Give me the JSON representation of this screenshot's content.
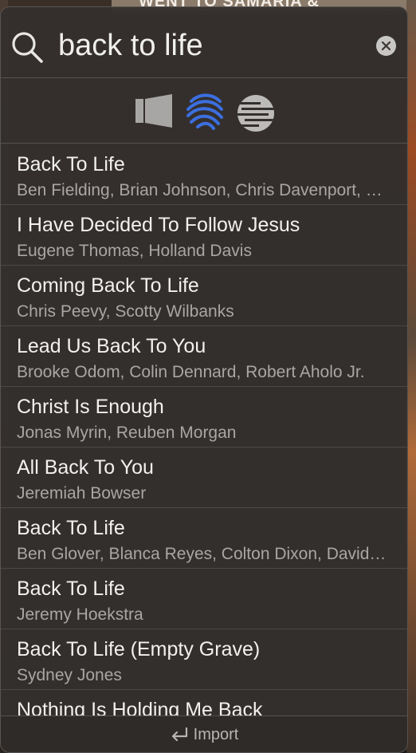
{
  "background": {
    "banner_text": "WENT TO SAMARIA &"
  },
  "search": {
    "query": "back to life",
    "icon": "magnifier-icon",
    "clear_icon": "clear-x-icon"
  },
  "sources": [
    {
      "name": "source-gray-icon",
      "color": "#a8a6a4"
    },
    {
      "name": "source-blue-icon",
      "color": "#3b6fe0"
    },
    {
      "name": "source-lines-icon",
      "color": "#bdbbb9"
    }
  ],
  "results": [
    {
      "title": "Back To Life",
      "subtitle": "Ben Fielding, Brian Johnson, Chris Davenport, Ed Cash"
    },
    {
      "title": "I Have Decided To Follow Jesus",
      "subtitle": "Eugene Thomas, Holland Davis"
    },
    {
      "title": "Coming Back To Life",
      "subtitle": "Chris Peevy, Scotty Wilbanks"
    },
    {
      "title": "Lead Us Back To You",
      "subtitle": "Brooke Odom, Colin Dennard, Robert Aholo Jr."
    },
    {
      "title": "Christ Is Enough",
      "subtitle": "Jonas Myrin, Reuben Morgan"
    },
    {
      "title": "All Back To You",
      "subtitle": "Jeremiah Bowser"
    },
    {
      "title": "Back To Life",
      "subtitle": "Ben Glover, Blanca Reyes, Colton Dixon, David Garcia"
    },
    {
      "title": "Back To Life",
      "subtitle": "Jeremy Hoekstra"
    },
    {
      "title": "Back To Life (Empty Grave)",
      "subtitle": "Sydney Jones"
    },
    {
      "title": "Nothing Is Holding Me Back",
      "subtitle": ""
    }
  ],
  "footer": {
    "import_label": "Import",
    "import_icon": "return-arrow-icon"
  }
}
